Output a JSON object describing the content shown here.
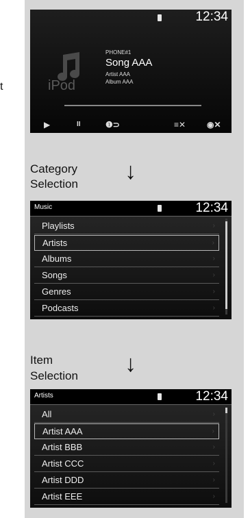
{
  "side_text": "t",
  "now_playing": {
    "time": "12:34",
    "art_label": "iPod",
    "source": "PHONE#1",
    "song": "Song AAA",
    "artist": "Artist AAA",
    "album": "Album AAA",
    "controls": {
      "play": "▶",
      "pause": "II",
      "repeat": "❶⊃",
      "shuffle": "≡✕",
      "shuffle_all": "◉✕"
    }
  },
  "arrows": [
    "↓",
    "↓"
  ],
  "labels": {
    "category_line1": "Category",
    "category_line2": "Selection",
    "item_line1": "Item",
    "item_line2": "Selection"
  },
  "category_screen": {
    "title": "Music",
    "time": "12:34",
    "items": [
      "Playlists",
      "Artists",
      "Albums",
      "Songs",
      "Genres",
      "Podcasts"
    ],
    "selected_index": 1
  },
  "item_screen": {
    "title": "Artists",
    "time": "12:34",
    "items": [
      "All",
      "Artist AAA",
      "Artist BBB",
      "Artist CCC",
      "Artist DDD",
      "Artist EEE"
    ],
    "selected_index": 1
  }
}
